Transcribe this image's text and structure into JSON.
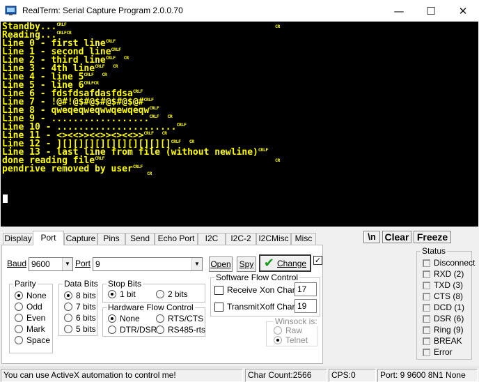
{
  "window": {
    "title": "RealTerm: Serial Capture Program 2.0.0.70",
    "min_glyph": "—",
    "max_glyph": "☐",
    "close_glyph": "✕"
  },
  "terminal": {
    "lines": [
      {
        "text": "Standby...",
        "tail": "CRLF",
        "cr_far": "CR"
      },
      {
        "text": "Reading...",
        "tail": "CRLFCR"
      },
      {
        "text": "Line 0 - first line",
        "tail": "CRLF"
      },
      {
        "text": "Line 1 - second line",
        "tail": "CRLF"
      },
      {
        "text": "Line 2 - third line",
        "tail": "CRLF",
        "cr_after": "CR"
      },
      {
        "text": "Line 3 - 4th line",
        "tail": "CRLF",
        "cr_after": "CR"
      },
      {
        "text": "Line 4 - line 5",
        "tail": "CRLF",
        "cr_after": "CR"
      },
      {
        "text": "Line 5 - line 6",
        "tail": "CRLFCR"
      },
      {
        "text": "Line 6 - fdsfdsafdasfdsa",
        "tail": "CRLF"
      },
      {
        "text": "Line 7 - !@#!@$#@$#@$#@$@#",
        "tail": "CRLF"
      },
      {
        "text": "Line 8 - qweqeqweqwwqewqeqw",
        "tail": "CRLF"
      },
      {
        "text": "Line 9 - ..................",
        "tail": "CRLF",
        "cr_after": "CR"
      },
      {
        "text": "Line 10 - ......................",
        "tail": "CRLF"
      },
      {
        "text": "Line 11 - <><<>><<>><><<>>",
        "tail": "CRLF",
        "cr_after": "CR"
      },
      {
        "text": "Line 12 - ][][][][][][][][][][]",
        "tail": "CRLF",
        "cr_after": "CR"
      },
      {
        "text": "Line 13 - last line from file (without newline)",
        "tail": "CRLF"
      },
      {
        "text": "done reading file",
        "tail": "CRLF",
        "cr_far": "CR"
      },
      {
        "text": "pendrive removed by user",
        "tail": "CRLF",
        "cr_below": "CR"
      }
    ]
  },
  "tabs": [
    "Display",
    "Port",
    "Capture",
    "Pins",
    "Send",
    "Echo Port",
    "I2C",
    "I2C-2",
    "I2CMisc",
    "Misc"
  ],
  "active_tab": "Port",
  "toolbar": {
    "newline": "\\n",
    "clear": "Clear",
    "freeze": "Freeze"
  },
  "port": {
    "baud_label": "Baud",
    "baud_value": "9600",
    "port_label": "Port",
    "port_value": "9",
    "open_label": "Open",
    "spy_label": "Spy",
    "change_label": "Change",
    "parity": {
      "title": "Parity",
      "options": [
        "None",
        "Odd",
        "Even",
        "Mark",
        "Space"
      ],
      "selected": "None"
    },
    "data_bits": {
      "title": "Data Bits",
      "options": [
        "8 bits",
        "7 bits",
        "6 bits",
        "5 bits"
      ],
      "selected": "8 bits"
    },
    "stop_bits": {
      "title": "Stop Bits",
      "options": [
        "1 bit",
        "2 bits"
      ],
      "selected": "1 bit"
    },
    "hw_flow": {
      "title": "Hardware Flow Control",
      "options": [
        "None",
        "RTS/CTS",
        "DTR/DSR",
        "RS485-rts"
      ],
      "selected": "None"
    },
    "sw_flow": {
      "title": "Software Flow Control",
      "receive_label": "Receive",
      "xon_label": "Xon Char:",
      "xon_value": "17",
      "transmit_label": "Transmit",
      "xoff_label": "Xoff Char:",
      "xoff_value": "19"
    },
    "winsock": {
      "title": "Winsock is:",
      "options": [
        "Raw",
        "Telnet"
      ],
      "selected": "Telnet"
    }
  },
  "status": {
    "title": "Status",
    "items": [
      "Disconnect",
      "RXD (2)",
      "TXD (3)",
      "CTS (8)",
      "DCD (1)",
      "DSR (6)",
      "Ring (9)",
      "BREAK",
      "Error"
    ]
  },
  "statusbar": {
    "message": "You can use ActiveX automation to control me!",
    "char_count": "Char Count:2566",
    "cps": "CPS:0",
    "port_info": "Port: 9 9600 8N1 None"
  }
}
